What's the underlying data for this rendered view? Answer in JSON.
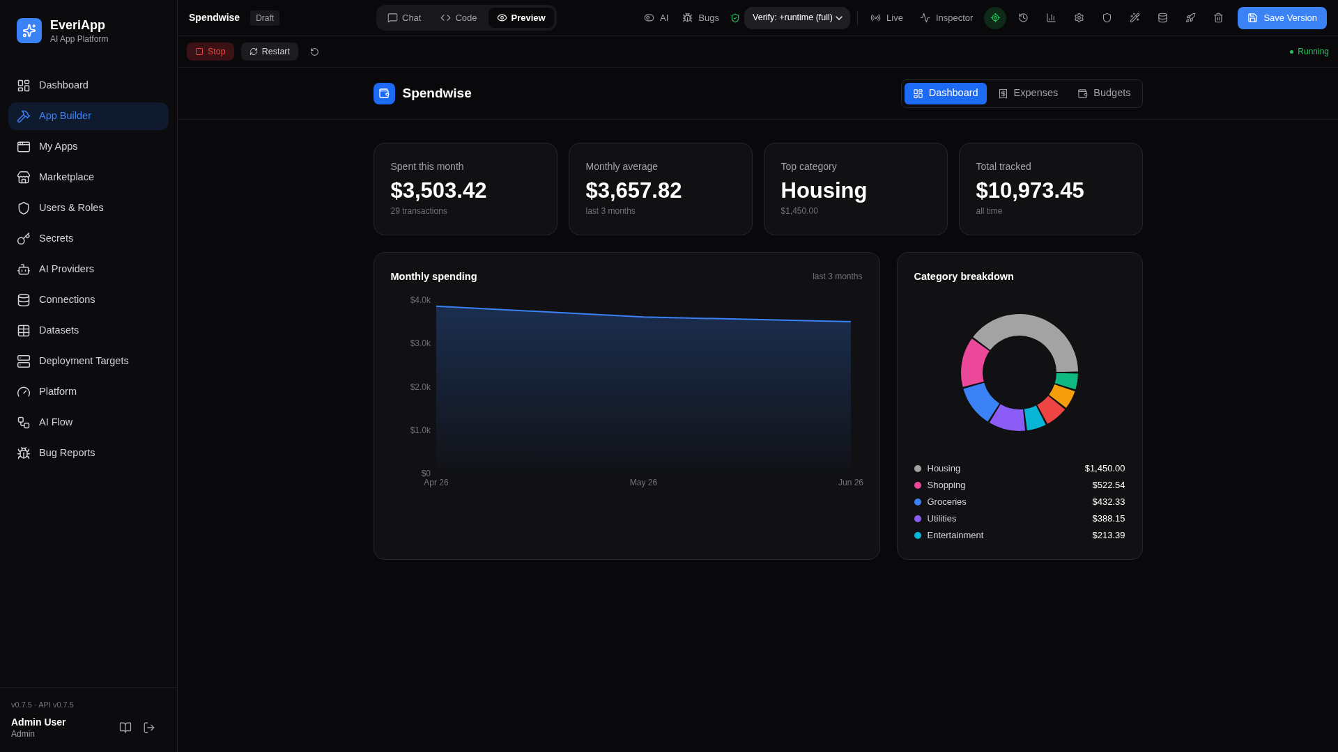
{
  "sidebar": {
    "brand": {
      "name": "EveriApp",
      "tagline": "AI App Platform"
    },
    "items": [
      {
        "label": "Dashboard",
        "selected": false
      },
      {
        "label": "App Builder",
        "selected": true
      },
      {
        "label": "My Apps",
        "selected": false
      },
      {
        "label": "Marketplace",
        "selected": false
      },
      {
        "label": "Users & Roles",
        "selected": false
      },
      {
        "label": "Secrets",
        "selected": false
      },
      {
        "label": "AI Providers",
        "selected": false
      },
      {
        "label": "Connections",
        "selected": false
      },
      {
        "label": "Datasets",
        "selected": false
      },
      {
        "label": "Deployment Targets",
        "selected": false
      },
      {
        "label": "Platform",
        "selected": false
      },
      {
        "label": "AI Flow",
        "selected": false
      },
      {
        "label": "Bug Reports",
        "selected": false
      }
    ],
    "footer": {
      "version": "v0.7.5 · API v0.7.5",
      "user_name": "Admin User",
      "user_role": "Admin"
    }
  },
  "topbar": {
    "project": "Spendwise",
    "badge": "Draft",
    "view_tabs": [
      {
        "label": "Chat",
        "selected": false
      },
      {
        "label": "Code",
        "selected": false
      },
      {
        "label": "Preview",
        "selected": true
      }
    ],
    "toggles": [
      {
        "label": "AI"
      },
      {
        "label": "Bugs"
      }
    ],
    "verify_select": {
      "value": "Verify: +runtime (full)"
    },
    "panels": [
      {
        "label": "Live"
      },
      {
        "label": "Inspector"
      }
    ],
    "icon_tools": [
      {
        "on": true
      },
      {
        "on": false
      },
      {
        "on": false
      },
      {
        "on": false
      },
      {
        "on": false
      },
      {
        "on": false
      },
      {
        "on": false
      },
      {
        "on": false
      },
      {
        "on": false
      }
    ],
    "save_button": {
      "label": "Save Version"
    }
  },
  "runbar": {
    "stop": "Stop",
    "restart": "Restart",
    "status": "Running"
  },
  "app": {
    "title": "Spendwise",
    "tabs": [
      {
        "label": "Dashboard",
        "selected": true
      },
      {
        "label": "Expenses",
        "selected": false
      },
      {
        "label": "Budgets",
        "selected": false
      }
    ],
    "stats": [
      {
        "label": "Spent this month",
        "value": "$3,503.42",
        "note": "29 transactions"
      },
      {
        "label": "Monthly average",
        "value": "$3,657.82",
        "note": "last 3 months"
      },
      {
        "label": "Top category",
        "value": "Housing",
        "note": "$1,450.00"
      },
      {
        "label": "Total tracked",
        "value": "$10,973.45",
        "note": "all time"
      }
    ],
    "spending": {
      "period": "last 3 months",
      "chart_data": {
        "type": "area",
        "title": "Monthly spending",
        "x": [
          "Apr 26",
          "May 26",
          "Jun 26"
        ],
        "series": [
          {
            "color": "#3b82f6",
            "values": [
              3860,
              3610,
              3503.42
            ]
          }
        ],
        "ylim": [
          0,
          4000
        ],
        "yticks": [
          {
            "value": 0,
            "label": "$0"
          },
          {
            "value": 1000,
            "label": "$1.0k"
          },
          {
            "value": 2000,
            "label": "$2.0k"
          },
          {
            "value": 3000,
            "label": "$3.0k"
          },
          {
            "value": 4000,
            "label": "$4.0k"
          }
        ]
      }
    },
    "breakdown": {
      "chart_data": {
        "type": "donut",
        "title": "Category breakdown",
        "values": [
          39.87,
          14.37,
          11.89,
          10.67,
          5.87,
          6.74,
          5.64,
          4.95
        ]
      },
      "legend": [
        {
          "label": "Housing",
          "amount": "$1,450.00",
          "color": "#a3a3a3"
        },
        {
          "label": "Shopping",
          "amount": "$522.54",
          "color": "#ec4899"
        },
        {
          "label": "Groceries",
          "amount": "$432.33",
          "color": "#3b82f6"
        },
        {
          "label": "Utilities",
          "amount": "$388.15",
          "color": "#8b5cf6"
        },
        {
          "label": "Entertainment",
          "amount": "$213.39",
          "color": "#06b6d4"
        }
      ],
      "other_slices": [
        {
          "color": "#ef4444"
        },
        {
          "color": "#f59e0b"
        },
        {
          "color": "#10b981"
        }
      ]
    }
  }
}
